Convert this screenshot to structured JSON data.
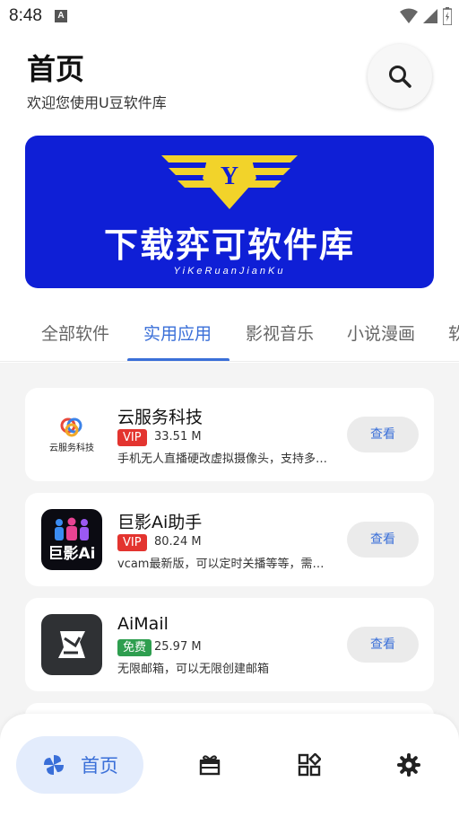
{
  "status_bar": {
    "time": "8:48",
    "app_icon_letter": "A"
  },
  "header": {
    "title": "首页",
    "subtitle": "欢迎您使用U豆软件库",
    "search_icon": "search-icon"
  },
  "banner": {
    "title": "下载弈可软件库",
    "subtitle": "YiKeRuanJianKu",
    "emblem_letter": "Y"
  },
  "tabs": [
    {
      "label": "全部软件"
    },
    {
      "label": "实用应用"
    },
    {
      "label": "影视音乐"
    },
    {
      "label": "小说漫画"
    },
    {
      "label": "软"
    }
  ],
  "active_tab": "实用应用",
  "apps": [
    {
      "name": "云服务科技",
      "badge": "VIP",
      "size": "33.51 M",
      "desc": "手机无人直播硬改虚拟摄像头，支持多…",
      "button": "查看",
      "icon_text": "云服务科技"
    },
    {
      "name": "巨影Ai助手",
      "badge": "VIP",
      "size": "80.24 M",
      "desc": "vcam最新版，可以定时关播等等，需…",
      "button": "查看",
      "icon_text": "巨影Ai"
    },
    {
      "name": "AiMail",
      "badge": "免费",
      "size": "25.97 M",
      "desc": "无限邮箱，可以无限创建邮箱",
      "button": "查看"
    }
  ],
  "bottom_nav": {
    "home_label": "首页",
    "icons": [
      "pinwheel-icon",
      "gift-icon",
      "apps-grid-icon",
      "settings-gear-icon"
    ]
  },
  "colors": {
    "accent": "#3a6fd8",
    "banner": "#0f1fd6",
    "vip": "#e3342f",
    "free": "#2e9e4f",
    "gold": "#f2d32a"
  }
}
